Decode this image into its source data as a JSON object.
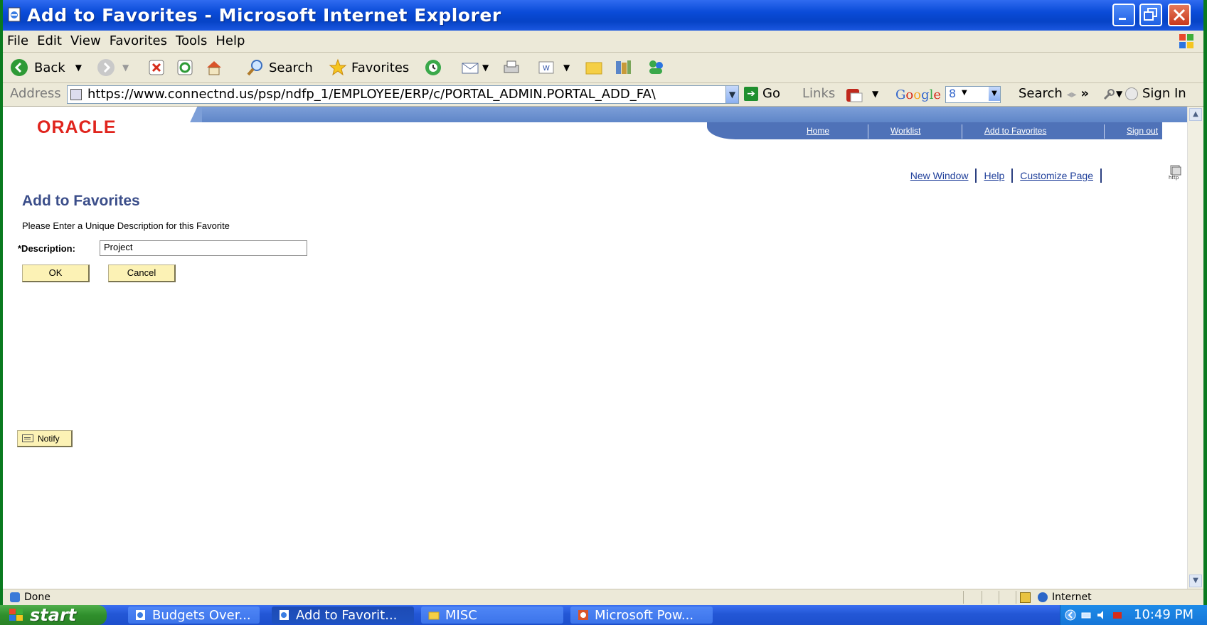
{
  "window": {
    "title": "Add to Favorites - Microsoft Internet Explorer"
  },
  "menu": [
    "File",
    "Edit",
    "View",
    "Favorites",
    "Tools",
    "Help"
  ],
  "toolbar": {
    "back_label": "Back",
    "search_label": "Search",
    "favorites_label": "Favorites"
  },
  "address": {
    "label": "Address",
    "url": "https://www.connectnd.us/psp/ndfp_1/EMPLOYEE/ERP/c/PORTAL_ADMIN.PORTAL_ADD_FA\\",
    "go_label": "Go",
    "links_label": "Links"
  },
  "google": {
    "logo": "Google",
    "box_value": "8",
    "search_label": "Search",
    "chevron": "»",
    "signin_label": "Sign In"
  },
  "portal": {
    "logo_text": "ORACLE",
    "nav": [
      "Home",
      "Worklist",
      "Add to Favorites",
      "Sign out"
    ],
    "page_links": [
      "New Window",
      "Help",
      "Customize Page"
    ],
    "http_icon_text": "http"
  },
  "page": {
    "title": "Add to Favorites",
    "instruction": "Please Enter a Unique Description for this Favorite",
    "description_label": "*Description:",
    "description_value": "Project",
    "ok_label": "OK",
    "cancel_label": "Cancel",
    "notify_label": "Notify"
  },
  "status": {
    "text": "Done",
    "zone": "Internet"
  },
  "taskbar": {
    "start_label": "start",
    "tasks": [
      "Budgets Over...",
      "Add to Favorit...",
      "MISC",
      "Microsoft Pow..."
    ],
    "clock": "10:49 PM"
  },
  "colors": {
    "desktop_border": "#0a7a1f",
    "titlebar": "#0a4bd8",
    "portal_nav": "#4f72b8",
    "page_title": "#3b4e8a",
    "button_face": "#fcf2b5",
    "oracle_red": "#e0241d"
  }
}
